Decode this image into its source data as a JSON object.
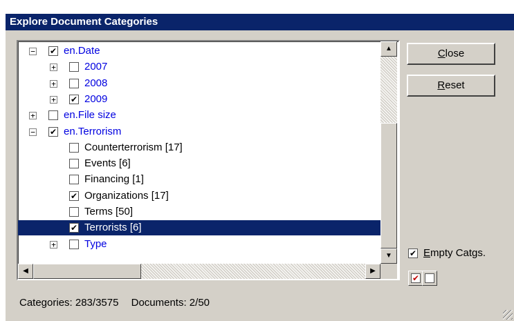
{
  "window": {
    "title": "Explore Document Categories"
  },
  "tree": [
    {
      "label": "en.Date",
      "level": 0,
      "expander": "minus",
      "checked": true,
      "link": true
    },
    {
      "label": "2007",
      "level": 1,
      "expander": "plus",
      "checked": false,
      "link": true
    },
    {
      "label": "2008",
      "level": 1,
      "expander": "plus",
      "checked": false,
      "link": true
    },
    {
      "label": "2009",
      "level": 1,
      "expander": "plus",
      "checked": true,
      "link": true
    },
    {
      "label": "en.File size",
      "level": 0,
      "expander": "plus",
      "checked": false,
      "link": true
    },
    {
      "label": "en.Terrorism",
      "level": 0,
      "expander": "minus",
      "checked": true,
      "link": true
    },
    {
      "label": "Counterterrorism  [17]",
      "level": 1,
      "expander": "none",
      "checked": false,
      "link": false
    },
    {
      "label": "Events  [6]",
      "level": 1,
      "expander": "none",
      "checked": false,
      "link": false
    },
    {
      "label": "Financing  [1]",
      "level": 1,
      "expander": "none",
      "checked": false,
      "link": false
    },
    {
      "label": "Organizations  [17]",
      "level": 1,
      "expander": "none",
      "checked": true,
      "link": false
    },
    {
      "label": "Terms  [50]",
      "level": 1,
      "expander": "none",
      "checked": false,
      "link": false
    },
    {
      "label": "Terrorists  [6]",
      "level": 1,
      "expander": "none",
      "checked": true,
      "link": false,
      "selected": true
    },
    {
      "label": "Type",
      "level": 1,
      "expander": "plus",
      "checked": false,
      "link": true
    }
  ],
  "buttons": {
    "close": {
      "label": "Close",
      "mnemonic": "C",
      "rest": "lose"
    },
    "reset": {
      "label": "Reset",
      "mnemonic": "R",
      "rest": "eset"
    }
  },
  "empty_catgs": {
    "label": "Empty Catgs.",
    "mnemonic": "E",
    "rest": "mpty Catgs.",
    "checked": true
  },
  "status": {
    "categories": "Categories: 283/3575",
    "documents": "Documents: 2/50"
  },
  "colors": {
    "title_bar": "#0a246a",
    "link": "#0000e0",
    "selection": "#0a246a",
    "face": "#d4d0c8"
  },
  "icons": {
    "check_all": "checked-red-icon",
    "uncheck_all": "unchecked-icon",
    "scroll_up": "arrow-up-icon",
    "scroll_down": "arrow-down-icon",
    "scroll_left": "arrow-left-icon",
    "scroll_right": "arrow-right-icon"
  }
}
